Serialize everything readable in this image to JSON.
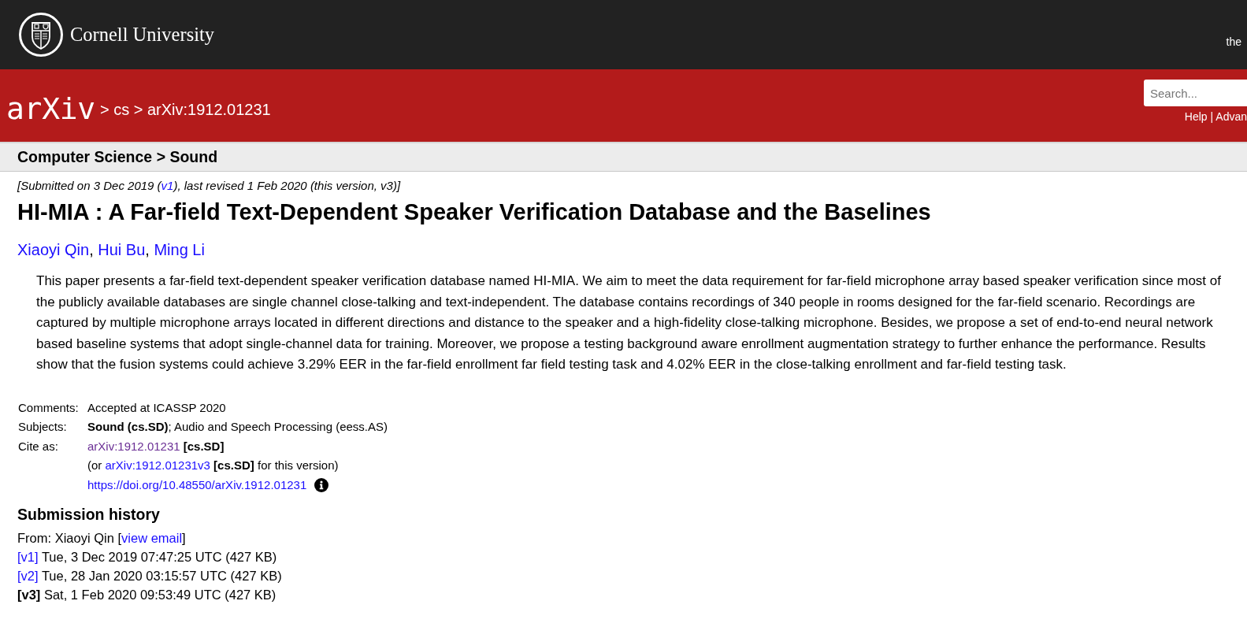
{
  "top_bar": {
    "university": "Cornell University",
    "right_text": "the"
  },
  "header": {
    "logo": "arXiv",
    "breadcrumb": "> cs > arXiv:1912.01231",
    "search": {
      "placeholder": "Search..."
    },
    "links": [
      "Help",
      "Advan"
    ],
    "link_separator": "|"
  },
  "subheader": "Computer Science > Sound",
  "dateline": {
    "before": "[Submitted on 3 Dec 2019 (",
    "link": "v1",
    "after": "), last revised 1 Feb 2020 (this version, v3)]"
  },
  "title": "HI-MIA : A Far-field Text-Dependent Speaker Verification Database and the Baselines",
  "authors": [
    "Xiaoyi Qin",
    "Hui Bu",
    "Ming Li"
  ],
  "author_separator": ",",
  "abstract": "This paper presents a far-field text-dependent speaker verification database named HI-MIA. We aim to meet the data requirement for far-field microphone array based speaker verification since most of the publicly available databases are single channel close-talking and text-independent. The database contains recordings of 340 people in rooms designed for the far-field scenario. Recordings are captured by multiple microphone arrays located in different directions and distance to the speaker and a high-fidelity close-talking microphone. Besides, we propose a set of end-to-end neural network based baseline systems that adopt single-channel data for training. Moreover, we propose a testing background aware enrollment augmentation strategy to further enhance the performance. Results show that the fusion systems could achieve 3.29% EER in the far-field enrollment far field testing task and 4.02% EER in the close-talking enrollment and far-field testing task.",
  "metadata": [
    {
      "label": "Comments:",
      "lines": [
        [
          {
            "kind": "text",
            "text": "Accepted at ICASSP 2020"
          }
        ]
      ]
    },
    {
      "label": "Subjects:",
      "lines": [
        [
          {
            "kind": "text",
            "text": "**Sound (cs.SD)**; Audio and Speech Processing (eess.AS)"
          }
        ]
      ]
    },
    {
      "label": "Cite as:",
      "lines": [
        [
          {
            "kind": "link",
            "text": "arXiv:1912.01231",
            "visited": true
          },
          {
            "kind": "text",
            "text": " **[cs.SD]**"
          }
        ],
        [
          {
            "kind": "text",
            "text": "(or "
          },
          {
            "kind": "link",
            "text": "arXiv:1912.01231v3",
            "visited": false
          },
          {
            "kind": "text",
            "text": " **[cs.SD]** for this version)"
          }
        ],
        [
          {
            "kind": "link",
            "text": "https://doi.org/10.48550/arXiv.1912.01231",
            "visited": false
          },
          {
            "kind": "info"
          }
        ]
      ]
    }
  ],
  "submission_history": {
    "heading": "Submission history",
    "from": {
      "before": "From: Xiaoyi Qin [",
      "link": "view email",
      "after": "]"
    },
    "versions": [
      {
        "label": "[v1]",
        "selected": false,
        "details": "Tue, 3 Dec 2019 07:47:25 UTC (427 KB)"
      },
      {
        "label": "[v2]",
        "selected": false,
        "details": "Tue, 28 Jan 2020 03:15:57 UTC (427 KB)"
      },
      {
        "label": "[v3]",
        "selected": true,
        "details": "Sat, 1 Feb 2020 09:53:49 UTC (427 KB)"
      }
    ]
  }
}
